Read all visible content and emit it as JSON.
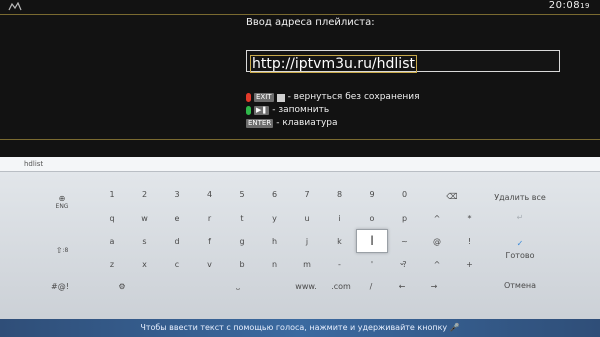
{
  "app": {
    "clock": "20:08",
    "clock_seconds": "19",
    "prompt": "Ввод адреса плейлиста:",
    "url_value": "http://iptvm3u.ru/hdlist",
    "legend": {
      "exit_key": "EXIT",
      "exit_text": "- вернуться без сохранения",
      "save_text": "- запомнить",
      "enter_key": "ENTER",
      "enter_text": "- клавиатура"
    }
  },
  "keyboard": {
    "input_value": "hdlist",
    "lang": "ENG",
    "numbers": [
      "1",
      "2",
      "3",
      "4",
      "5",
      "6",
      "7",
      "8",
      "9",
      "0"
    ],
    "row1": [
      "q",
      "w",
      "e",
      "r",
      "t",
      "y",
      "u",
      "i",
      "o",
      "p",
      "^",
      "*"
    ],
    "row2": [
      "a",
      "s",
      "d",
      "f",
      "g",
      "h",
      "j",
      "k",
      "l",
      "~",
      "@",
      "!"
    ],
    "row3": [
      "z",
      "x",
      "c",
      "v",
      "b",
      "n",
      "m",
      "-",
      "'",
      "?",
      "^",
      "+"
    ],
    "row4_left": "#@!",
    "row4_www": "www.",
    "row4_com": ".com",
    "row4_slash": "/",
    "shift_sub": ":8",
    "selected_key": "l",
    "delete_all": "Удалить все",
    "done": "Готово",
    "cancel": "Отмена",
    "voice_hint": "Чтобы ввести текст с помощью голоса, нажмите и удерживайте кнопку"
  },
  "colors": {
    "red_button": "#e23a2a",
    "green_button": "#2fb84a",
    "accent_line": "#7a6a30",
    "done_check": "#3a8ad8"
  }
}
